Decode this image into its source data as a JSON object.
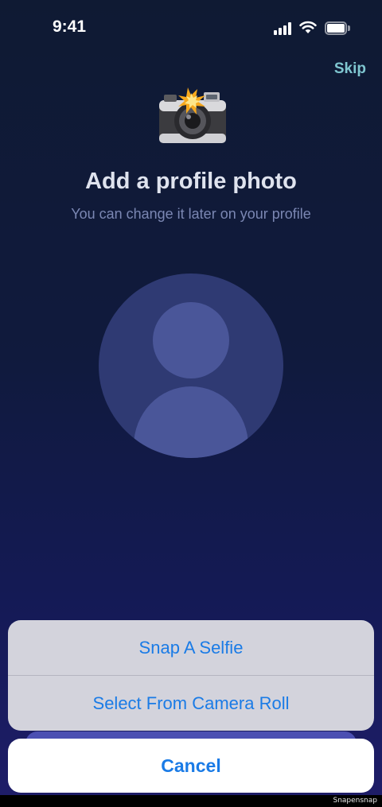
{
  "status_bar": {
    "time": "9:41",
    "icons": [
      "signal-icon",
      "wifi-icon",
      "battery-icon"
    ]
  },
  "header": {
    "skip_label": "Skip"
  },
  "main": {
    "icon": "camera-with-flash-icon",
    "title": "Add a profile photo",
    "subtitle": "You can change it later on your profile",
    "avatar_icon": "person-placeholder-icon"
  },
  "action_sheet": {
    "options": [
      {
        "label": "Snap A Selfie"
      },
      {
        "label": "Select From Camera Roll"
      }
    ],
    "cancel_label": "Cancel"
  },
  "footer": {
    "watermark": "Snapensnap"
  },
  "colors": {
    "accent_link": "#1a7be6",
    "skip": "#7fc6d0",
    "background_top": "#0f1a33",
    "background_bottom": "#1e1d68"
  }
}
